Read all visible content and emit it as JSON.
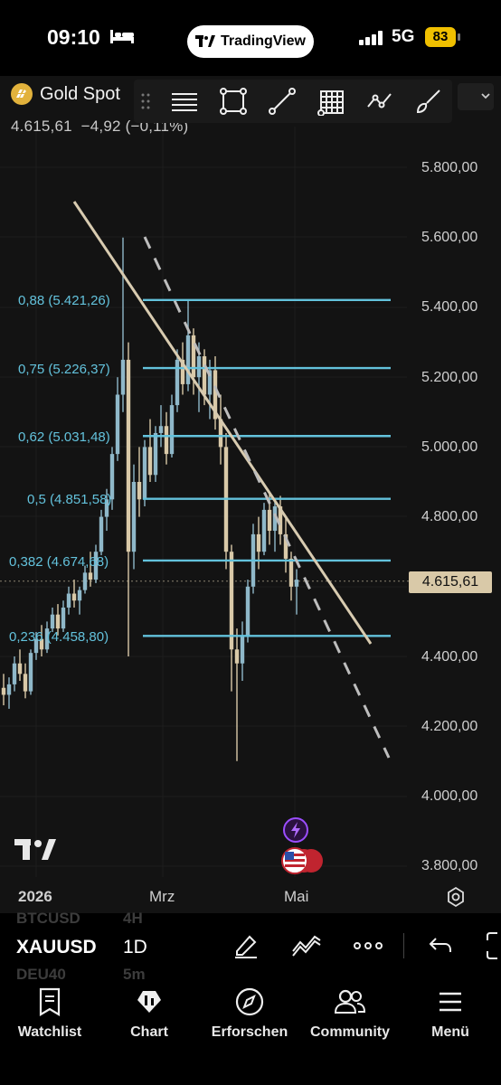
{
  "status_bar": {
    "time": "09:10",
    "app_pill": "TradingView",
    "network": "5G",
    "battery": "83"
  },
  "header": {
    "symbol_name": "Gold Spot",
    "last_price": "4.615,61",
    "change": "−4,92",
    "change_pct": "(−0,11%)"
  },
  "drawing_toolbar": {
    "tools": [
      "horizontal-lines-icon",
      "rectangle-icon",
      "trend-line-icon",
      "grid-icon",
      "pattern-icon",
      "brush-icon"
    ]
  },
  "price_axis": {
    "labels": [
      "5.800,00",
      "5.600,00",
      "5.400,00",
      "5.200,00",
      "5.000,00",
      "4.800,00",
      "4.400,00",
      "4.200,00",
      "4.000,00",
      "3.800,00"
    ],
    "current_price": "4.615,61"
  },
  "fib_levels": [
    {
      "ratio": "0,88",
      "price": "(5.421,26)"
    },
    {
      "ratio": "0,75",
      "price": "(5.226,37)"
    },
    {
      "ratio": "0,62",
      "price": "(5.031,48)"
    },
    {
      "ratio": "0,5",
      "price": "(4.851,58)"
    },
    {
      "ratio": "0,382",
      "price": "(4.674,68)"
    },
    {
      "ratio": "0,236",
      "price": "(4.458,80)"
    }
  ],
  "time_axis": {
    "labels": [
      "2026",
      "Mrz",
      "Mai"
    ]
  },
  "symbol_bar": {
    "ghost_above": {
      "symbol": "BTCUSD",
      "timeframe": "4H"
    },
    "current": {
      "symbol": "XAUUSD",
      "timeframe": "1D"
    },
    "ghost_below": {
      "symbol": "DEU40",
      "timeframe": "5m"
    }
  },
  "bottom_nav": [
    {
      "label": "Watchlist",
      "icon": "watchlist-icon"
    },
    {
      "label": "Chart",
      "icon": "chart-icon"
    },
    {
      "label": "Erforschen",
      "icon": "compass-icon"
    },
    {
      "label": "Community",
      "icon": "community-icon"
    },
    {
      "label": "Menü",
      "icon": "menu-icon"
    }
  ],
  "colors": {
    "fib": "#63c2dc",
    "trendline": "#d8cbb0",
    "price_tag": "#d9c9a8",
    "battery": "#f0c000"
  },
  "chart_data": {
    "type": "line",
    "candles": [
      [
        4310,
        4350,
        4260,
        4290
      ],
      [
        4290,
        4340,
        4250,
        4320
      ],
      [
        4320,
        4400,
        4300,
        4380
      ],
      [
        4380,
        4420,
        4330,
        4350
      ],
      [
        4350,
        4380,
        4280,
        4300
      ],
      [
        4300,
        4420,
        4290,
        4410
      ],
      [
        4410,
        4470,
        4390,
        4450
      ],
      [
        4450,
        4490,
        4400,
        4420
      ],
      [
        4420,
        4500,
        4410,
        4480
      ],
      [
        4480,
        4540,
        4470,
        4520
      ],
      [
        4520,
        4550,
        4460,
        4480
      ],
      [
        4480,
        4560,
        4470,
        4540
      ],
      [
        4540,
        4600,
        4520,
        4580
      ],
      [
        4580,
        4620,
        4540,
        4560
      ],
      [
        4560,
        4600,
        4520,
        4590
      ],
      [
        4590,
        4660,
        4580,
        4640
      ],
      [
        4640,
        4700,
        4600,
        4620
      ],
      [
        4620,
        4720,
        4610,
        4700
      ],
      [
        4700,
        4820,
        4690,
        4800
      ],
      [
        4800,
        4880,
        4760,
        4850
      ],
      [
        4850,
        5000,
        4820,
        4980
      ],
      [
        4980,
        5200,
        4960,
        5150
      ],
      [
        5150,
        5600,
        5100,
        5250
      ],
      [
        5250,
        5300,
        4400,
        4700
      ],
      [
        4700,
        4950,
        4650,
        4900
      ],
      [
        4900,
        5000,
        4800,
        4850
      ],
      [
        4850,
        5020,
        4830,
        5000
      ],
      [
        5000,
        5080,
        4900,
        4920
      ],
      [
        4920,
        5060,
        4900,
        5040
      ],
      [
        5040,
        5120,
        5000,
        5060
      ],
      [
        5060,
        5100,
        4950,
        4980
      ],
      [
        4980,
        5150,
        4970,
        5120
      ],
      [
        5120,
        5280,
        5100,
        5250
      ],
      [
        5250,
        5300,
        5150,
        5180
      ],
      [
        5180,
        5420,
        5160,
        5320
      ],
      [
        5320,
        5340,
        5150,
        5200
      ],
      [
        5200,
        5300,
        5100,
        5260
      ],
      [
        5260,
        5280,
        5120,
        5150
      ],
      [
        5150,
        5250,
        5080,
        5220
      ],
      [
        5220,
        5260,
        5050,
        5080
      ],
      [
        5080,
        5150,
        4950,
        5000
      ],
      [
        5000,
        5040,
        4650,
        4700
      ],
      [
        4700,
        4720,
        4300,
        4420
      ],
      [
        4420,
        4480,
        4100,
        4380
      ],
      [
        4380,
        4500,
        4330,
        4460
      ],
      [
        4460,
        4620,
        4440,
        4600
      ],
      [
        4600,
        4780,
        4580,
        4750
      ],
      [
        4750,
        4800,
        4650,
        4700
      ],
      [
        4700,
        4840,
        4690,
        4820
      ],
      [
        4820,
        4870,
        4720,
        4760
      ],
      [
        4760,
        4850,
        4700,
        4830
      ],
      [
        4830,
        4860,
        4720,
        4750
      ],
      [
        4750,
        4800,
        4640,
        4680
      ],
      [
        4680,
        4700,
        4560,
        4600
      ],
      [
        4600,
        4650,
        4520,
        4620
      ]
    ],
    "fib_levels": [
      5421.26,
      5226.37,
      5031.48,
      4851.58,
      4674.68,
      4458.8
    ],
    "ylim": [
      3770,
      5880
    ]
  }
}
